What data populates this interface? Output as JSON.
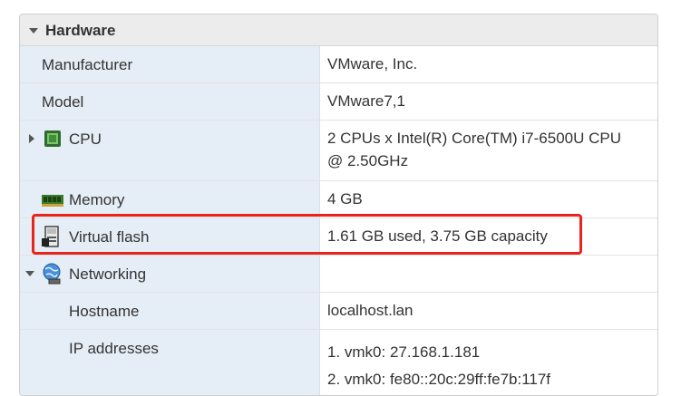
{
  "section": {
    "title": "Hardware"
  },
  "rows": {
    "manufacturer": {
      "label": "Manufacturer",
      "value": "VMware, Inc."
    },
    "model": {
      "label": "Model",
      "value": "VMware7,1"
    },
    "cpu": {
      "label": "CPU",
      "value_line1": "2 CPUs x Intel(R) Core(TM) i7-6500U CPU",
      "value_line2": "@ 2.50GHz"
    },
    "memory": {
      "label": "Memory",
      "value": "4 GB"
    },
    "virtual_flash": {
      "label": "Virtual flash",
      "value": "1.61 GB used, 3.75 GB capacity"
    },
    "networking": {
      "label": "Networking",
      "value": ""
    },
    "hostname": {
      "label": "Hostname",
      "value": "localhost.lan"
    },
    "ip_addresses": {
      "label": "IP addresses",
      "values": [
        "1. vmk0: 27.168.1.181",
        "2. vmk0: fe80::20c:29ff:fe7b:117f"
      ]
    }
  },
  "colors": {
    "highlight": "#e8241c",
    "label_column_bg": "#e5eef6",
    "header_bg": "#ececec"
  },
  "icons": {
    "cpu": "cpu-chip-icon",
    "memory": "memory-module-icon",
    "virtual_flash": "flash-storage-icon",
    "networking": "globe-network-icon"
  }
}
